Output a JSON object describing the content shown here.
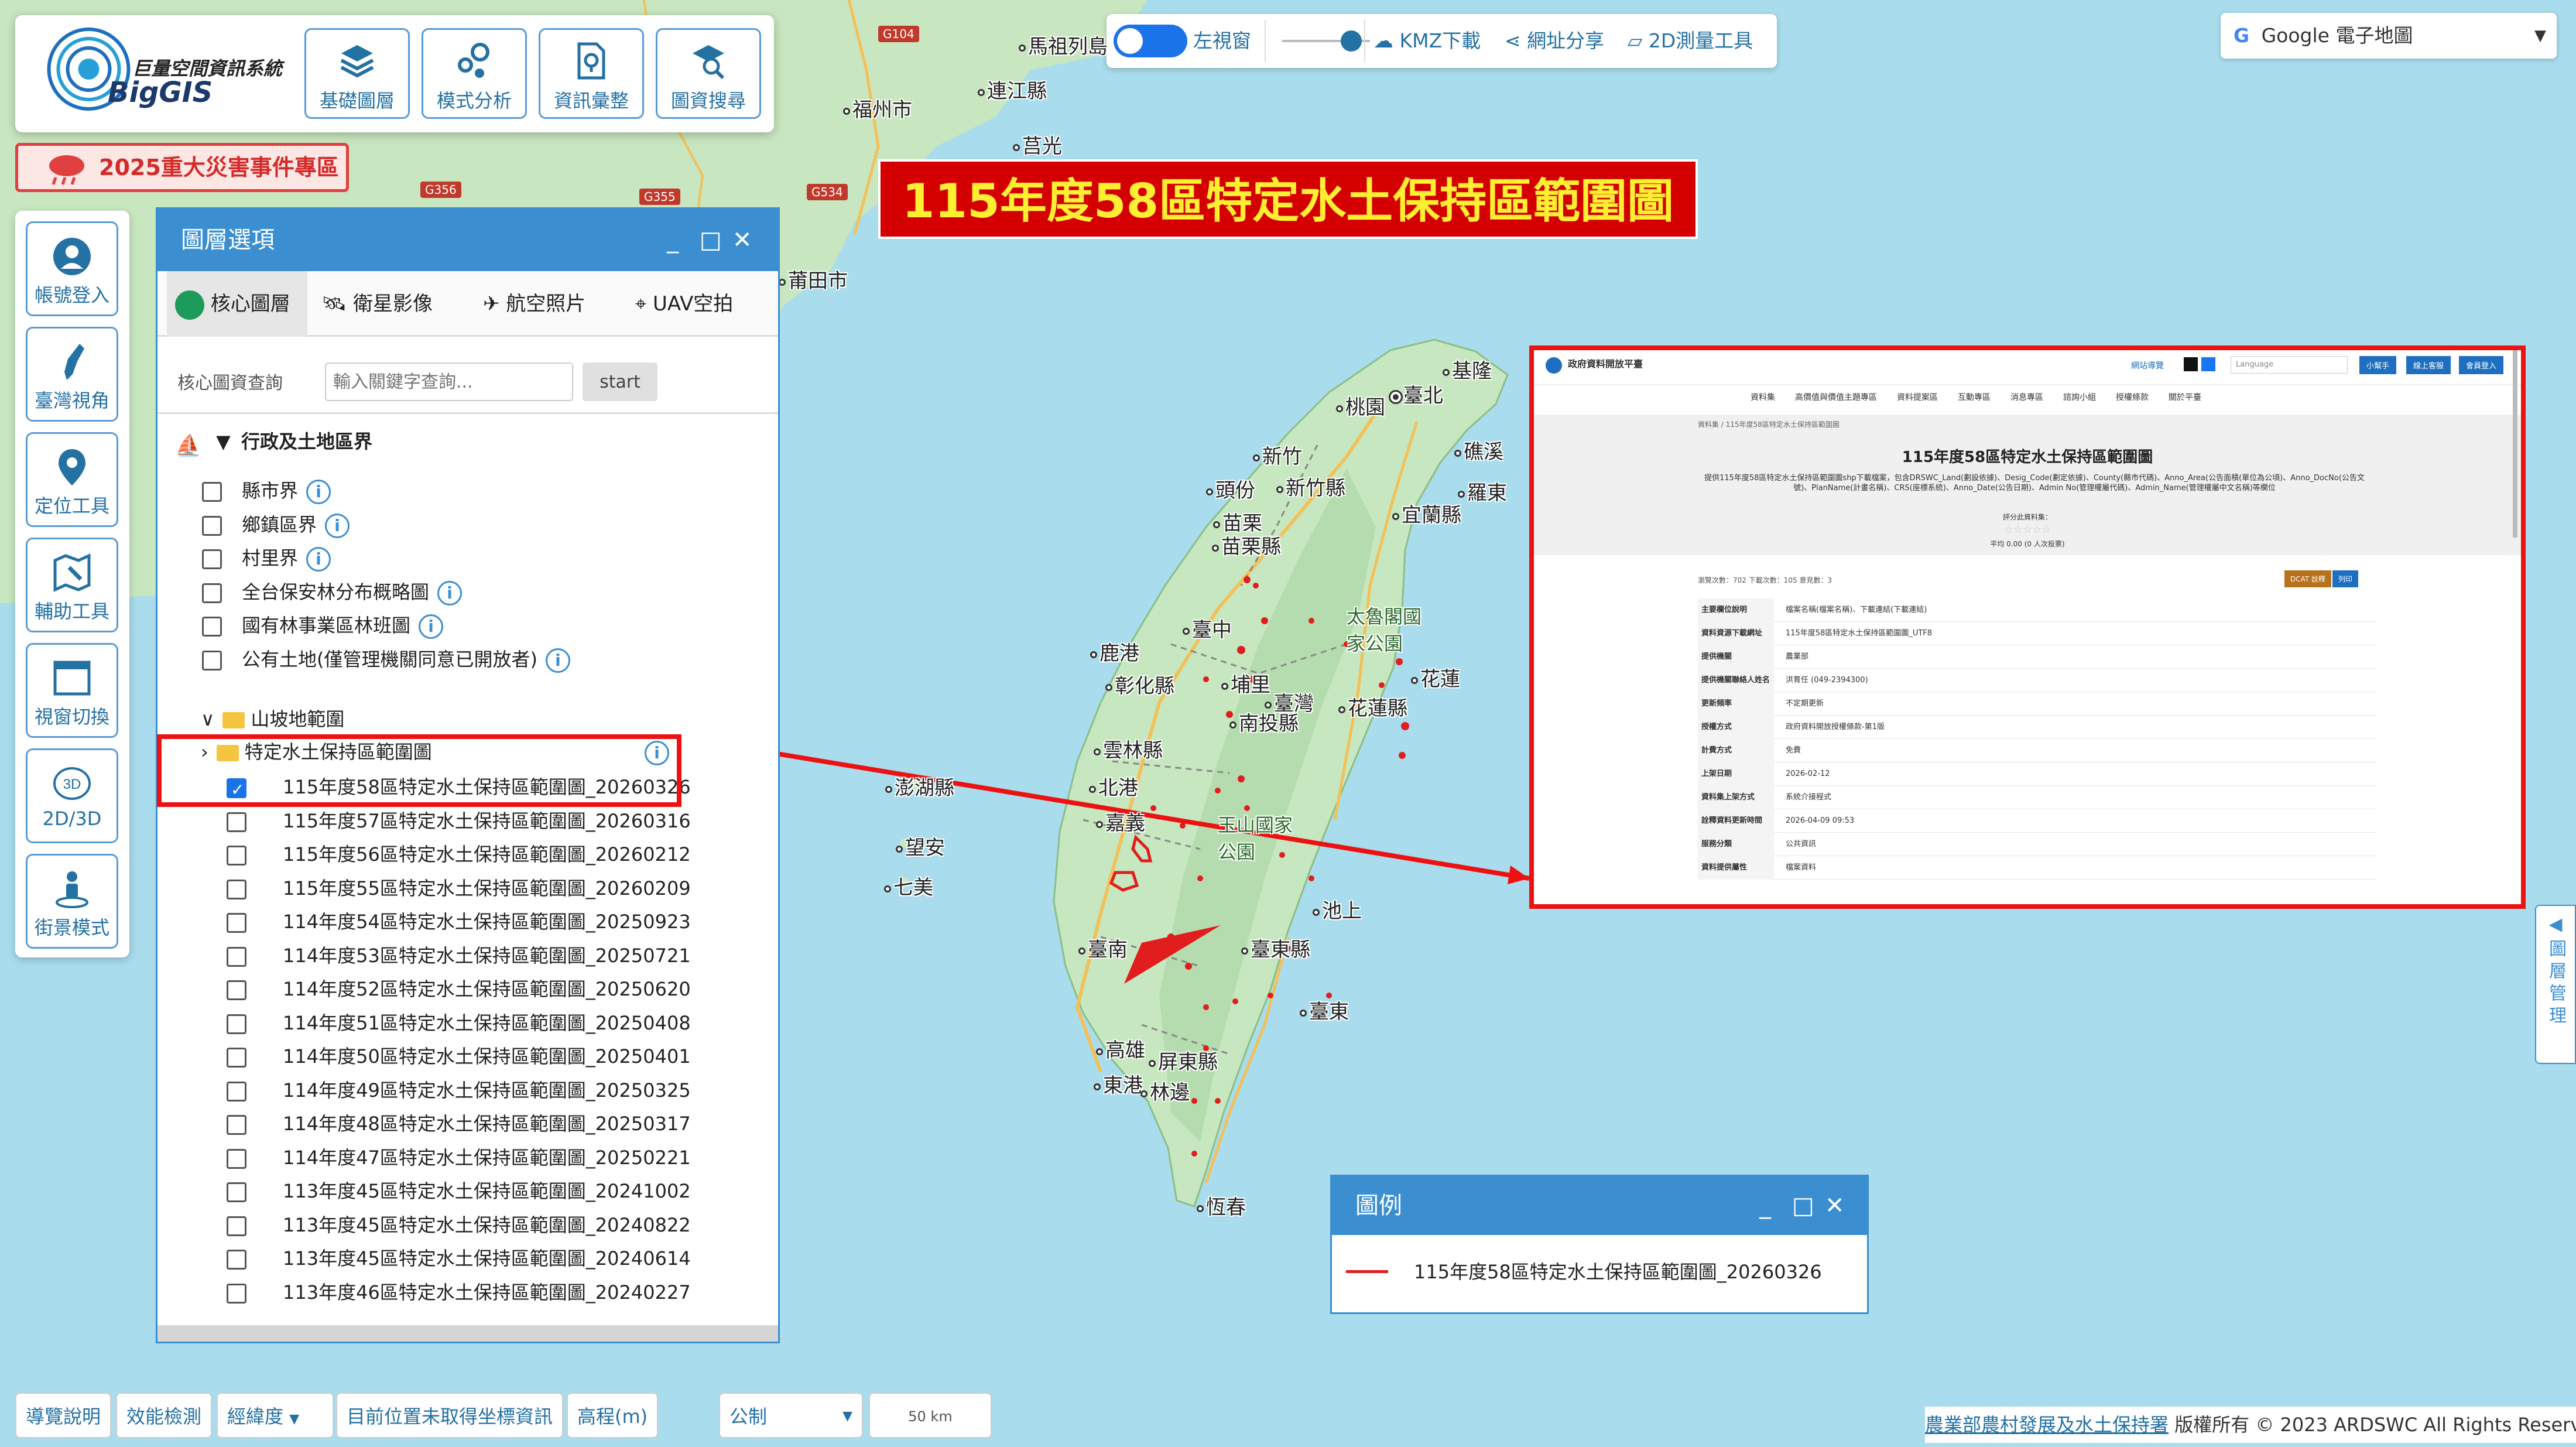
{
  "app": {
    "logo_title": "巨量空間資訊系統",
    "logo_name": "BigGIS"
  },
  "top_buttons": [
    {
      "label": "基礎圖層",
      "icon": "layers-icon"
    },
    {
      "label": "模式分析",
      "icon": "analysis-icon"
    },
    {
      "label": "資訊彙整",
      "icon": "document-location-icon"
    },
    {
      "label": "圖資搜尋",
      "icon": "map-search-icon"
    }
  ],
  "disaster_button": "2025重大災害事件專區",
  "left_tools": [
    {
      "label": "帳號登入",
      "icon": "user-icon"
    },
    {
      "label": "臺灣視角",
      "icon": "taiwan-icon"
    },
    {
      "label": "定位工具",
      "icon": "location-pin-icon"
    },
    {
      "label": "輔助工具",
      "icon": "map-tools-icon"
    },
    {
      "label": "視窗切換",
      "icon": "window-icon"
    },
    {
      "label": "2D/3D",
      "icon": "3d-icon",
      "badge": "3D"
    },
    {
      "label": "街景模式",
      "icon": "street-view-icon"
    }
  ],
  "toolbar": {
    "left_view": "左視窗",
    "kmz": "KMZ下載",
    "share": "網址分享",
    "measure": "2D測量工具"
  },
  "basemap": "Google 電子地圖",
  "map_title": "115年度58區特定水土保持區範圍圖",
  "map_labels": {
    "cities": [
      "福州市",
      "莆田市",
      "臺北",
      "桃園",
      "新竹",
      "苗栗",
      "臺中",
      "彰化縣",
      "雲林縣",
      "嘉義",
      "臺南",
      "高雄",
      "屏東縣",
      "臺東縣",
      "花蓮縣",
      "宜蘭縣",
      "南投縣",
      "基隆",
      "新竹縣",
      "苗栗縣",
      "北港",
      "東港",
      "林邊",
      "恆春",
      "頭份",
      "鹿港",
      "埔里",
      "臺東",
      "池上",
      "羅東",
      "礁溪",
      "花蓮",
      "澎湖縣",
      "望安",
      "七美",
      "連江縣",
      "莒光",
      "臺灣",
      "馬祖列島"
    ],
    "parks": [
      "太魯閣國家公園",
      "玉山國家公園"
    ],
    "roads": [
      "G104",
      "G356",
      "G355",
      "G534"
    ]
  },
  "layer_panel": {
    "title": "圖層選項",
    "tabs": [
      "核心圖層",
      "衛星影像",
      "航空照片",
      "UAV空拍"
    ],
    "search_label": "核心圖資查詢",
    "search_placeholder": "輸入關鍵字查詢...",
    "search_button": "start",
    "group_title": "行政及土地區界",
    "group_items": [
      "縣市界",
      "鄉鎮區界",
      "村里界",
      "全台保安林分布概略圖",
      "國有林事業區林班圖",
      "公有土地(僅管理機關同意已開放者)"
    ],
    "folders": [
      "山坡地範圍",
      "特定水土保持區範圍圖"
    ],
    "layers": [
      {
        "label": "115年度58區特定水土保持區範圍圖_20260326",
        "checked": true
      },
      {
        "label": "115年度57區特定水土保持區範圍圖_20260316",
        "checked": false
      },
      {
        "label": "115年度56區特定水土保持區範圍圖_20260212",
        "checked": false
      },
      {
        "label": "115年度55區特定水土保持區範圍圖_20260209",
        "checked": false
      },
      {
        "label": "114年度54區特定水土保持區範圍圖_20250923",
        "checked": false
      },
      {
        "label": "114年度53區特定水土保持區範圍圖_20250721",
        "checked": false
      },
      {
        "label": "114年度52區特定水土保持區範圍圖_20250620",
        "checked": false
      },
      {
        "label": "114年度51區特定水土保持區範圍圖_20250408",
        "checked": false
      },
      {
        "label": "114年度50區特定水土保持區範圍圖_20250401",
        "checked": false
      },
      {
        "label": "114年度49區特定水土保持區範圍圖_20250325",
        "checked": false
      },
      {
        "label": "114年度48區特定水土保持區範圍圖_20250317",
        "checked": false
      },
      {
        "label": "114年度47區特定水土保持區範圍圖_20250221",
        "checked": false
      },
      {
        "label": "113年度45區特定水土保持區範圍圖_20241002",
        "checked": false
      },
      {
        "label": "113年度45區特定水土保持區範圍圖_20240822",
        "checked": false
      },
      {
        "label": "113年度45區特定水土保持區範圍圖_20240614",
        "checked": false
      },
      {
        "label": "113年度46區特定水土保持區範圍圖_20240227",
        "checked": false
      }
    ]
  },
  "screenshot": {
    "site_name": "政府資料開放平臺",
    "nav": [
      "資料集",
      "高價值與價值主題專區",
      "資料提案區",
      "互動專區",
      "消息專區",
      "諮詢小組",
      "授權條款",
      "關於平臺"
    ],
    "header_links": [
      "網站導覽",
      "Language",
      "小幫手",
      "線上客服",
      "會員登入"
    ],
    "breadcrumb": "資料集 / 115年度58區特定水土保持區範圍圖",
    "title": "115年度58區特定水土保持區範圍圖",
    "desc": "提供115年度58區特定水土保持區範圍圖shp下載檔案，包含DRSWC_Land(劃設依據)、Desig_Code(劃定依據)、County(縣市代碼)、Anno_Area(公告面積(單位為公頃)、Anno_DocNo(公告文號)、PlanName(計畫名稱)、CRS(座標系統)、Anno_Date(公告日期)、Admin No(管理權屬代碼)、Admin_Name(管理權屬中文名稱)等欄位",
    "rating_label": "評分此資料集：",
    "rating_avg": "平均 0.00 (0 人次投票)",
    "stats": "瀏覽次數：702  下載次數：105  意見數：3",
    "btn_dcat": "DCAT 詮釋",
    "btn_print": "列印",
    "fields": [
      [
        "主要欄位說明",
        "檔案名稱(檔案名稱)、下載連結(下載連結)"
      ],
      [
        "資料資源下載網址",
        "115年度58區特定水土保持區範圍圖_UTF8"
      ],
      [
        "提供機關",
        "農業部"
      ],
      [
        "提供機關聯絡人姓名",
        "洪育任 (049-2394300)"
      ],
      [
        "更新頻率",
        "不定期更新"
      ],
      [
        "授權方式",
        "政府資料開放授權條款-第1版"
      ],
      [
        "計費方式",
        "免費"
      ],
      [
        "上架日期",
        "2026-02-12"
      ],
      [
        "資料集上架方式",
        "系統介接程式"
      ],
      [
        "詮釋資料更新時間",
        "2026-04-09 09:53"
      ],
      [
        "服務分類",
        "公共資訊"
      ],
      [
        "資料提供屬性",
        "檔案資料"
      ]
    ]
  },
  "legend": {
    "title": "圖例",
    "item": "115年度58區特定水土保持區範圍圖_20260326",
    "color": "#e11d1d"
  },
  "bottom_bar": {
    "guide": "導覽說明",
    "perf": "效能檢測",
    "coord": "經緯度",
    "coord_status": "目前位置未取得坐標資訊",
    "elev": "高程(m)",
    "unit": "公制",
    "scale": "50 km"
  },
  "copyright": {
    "org": "農業部農村發展及水土保持署",
    "text": " 版權所有 © 2023 ARDSWC All Rights Reserved."
  },
  "side_tab": "圖層管理",
  "colors": {
    "accent": "#3b8fd1",
    "title_bg": "#d40000",
    "title_fg": "#ffef33",
    "land": "#c7e7c0",
    "water": "#a9dcec",
    "highlight": "#e11d1d"
  }
}
